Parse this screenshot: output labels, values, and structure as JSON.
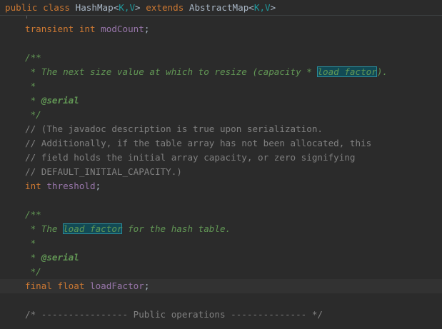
{
  "breadcrumb": {
    "kw_public": "public",
    "kw_class": "class",
    "class_name": "HashMap",
    "lt1": "<",
    "generic1": "K,V",
    "gt1": ">",
    "kw_extends": "extends",
    "super_name": "AbstractMap",
    "lt2": "<",
    "generic2": "K,V",
    "gt2": ">"
  },
  "code": {
    "l1": {
      "kw": "transient int",
      "name": "modCount",
      "punct": ";"
    },
    "l2": {
      "text": "/**"
    },
    "l3": {
      "pre": " * The next size value at which to resize (capacity * ",
      "hl": "load factor",
      "post": ")."
    },
    "l4": {
      "text": " *"
    },
    "l5": {
      "pre": " * ",
      "tag": "@serial"
    },
    "l6": {
      "text": " */"
    },
    "l7": {
      "text": "// (The javadoc description is true upon serialization."
    },
    "l8": {
      "text": "// Additionally, if the table array has not been allocated, this"
    },
    "l9": {
      "text": "// field holds the initial array capacity, or zero signifying"
    },
    "l10": {
      "text": "// DEFAULT_INITIAL_CAPACITY.)"
    },
    "l11": {
      "kw": "int",
      "name": "threshold",
      "punct": ";"
    },
    "l12": {
      "text": "/**"
    },
    "l13": {
      "pre": " * The ",
      "hl": "load factor",
      "post": " for the hash table."
    },
    "l14": {
      "text": " *"
    },
    "l15": {
      "pre": " * ",
      "tag": "@serial"
    },
    "l16": {
      "text": " */"
    },
    "l17": {
      "kw": "final float",
      "name": "loadFactor",
      "punct": ";"
    },
    "l18": {
      "text": "/* ---------------- Public operations -------------- */"
    }
  },
  "colors": {
    "background": "#2b2b2b",
    "keyword": "#cc7832",
    "field": "#9876aa",
    "doc_comment": "#629755",
    "line_comment": "#808080",
    "generic": "#20999d",
    "highlight": "#124a55"
  }
}
